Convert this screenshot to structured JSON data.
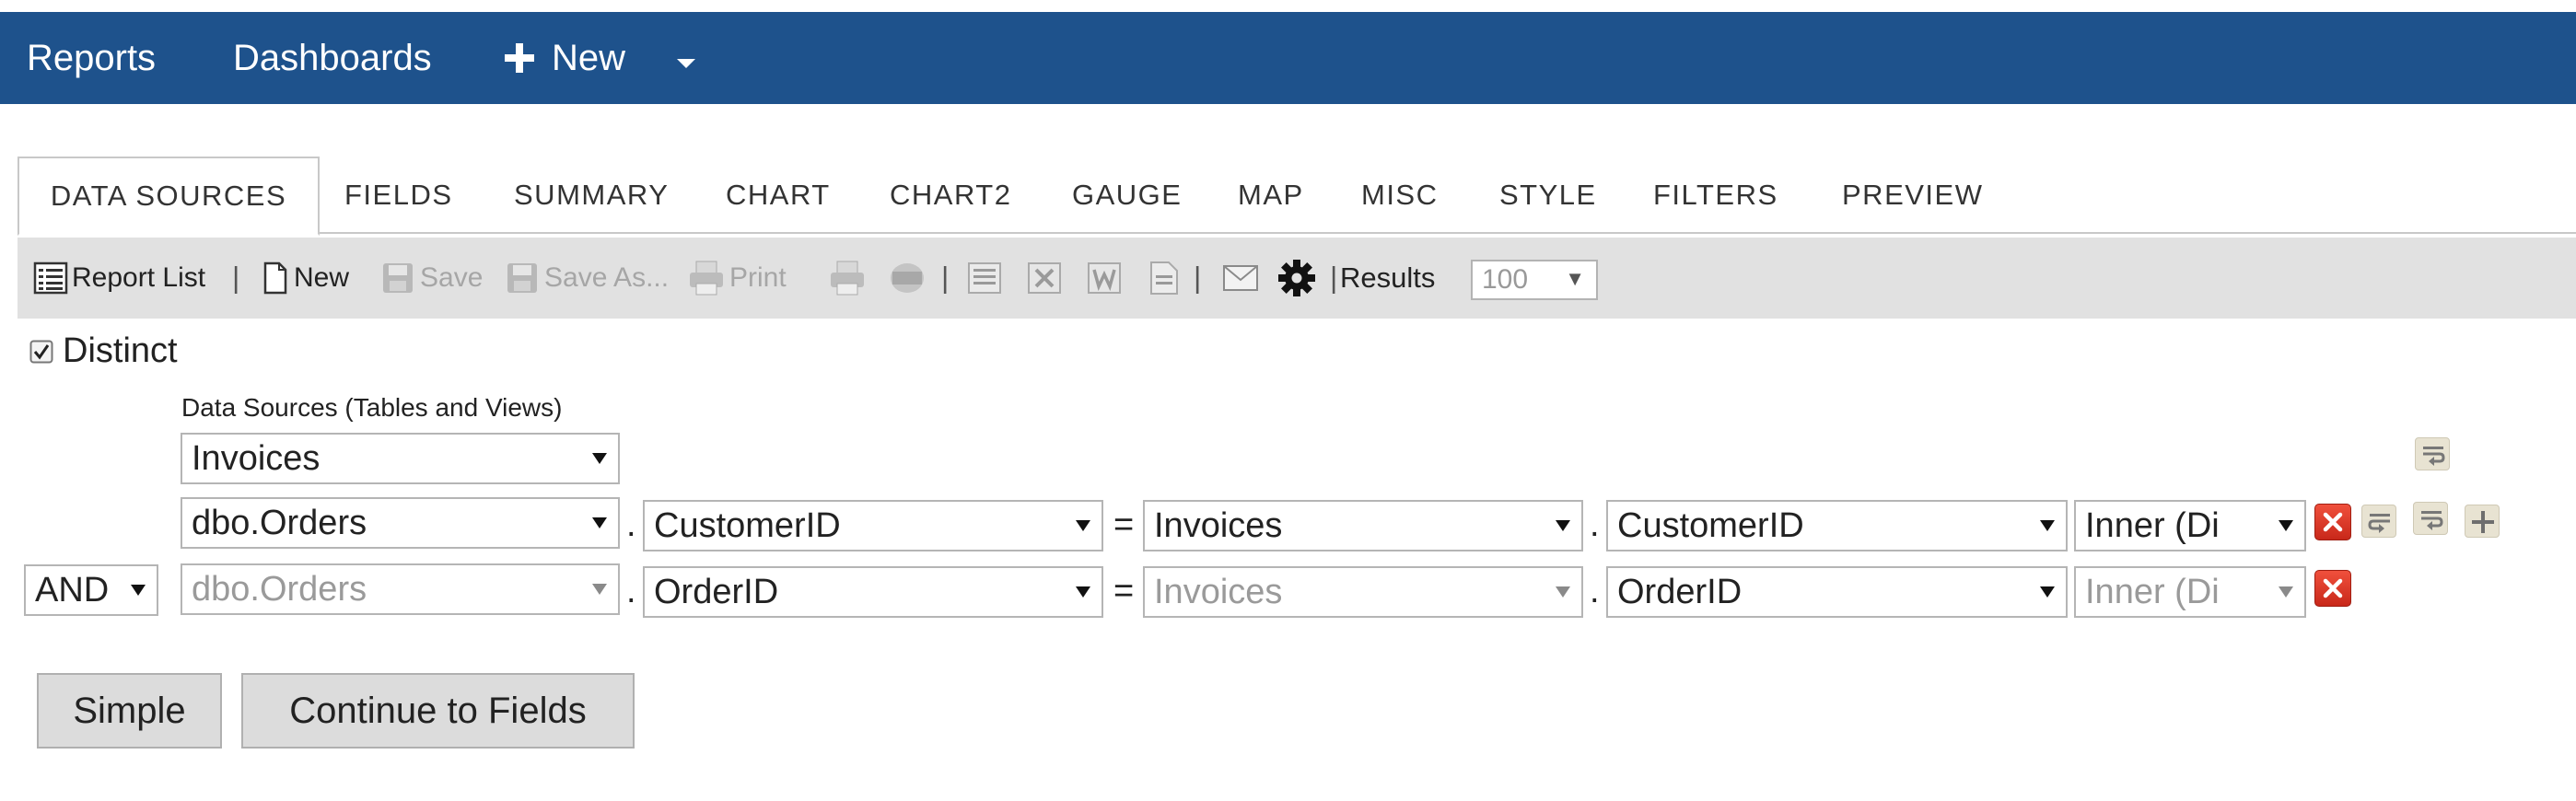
{
  "topnav": {
    "reports": "Reports",
    "dashboards": "Dashboards",
    "new": "New"
  },
  "tabs": [
    "DATA SOURCES",
    "FIELDS",
    "SUMMARY",
    "CHART",
    "CHART2",
    "GAUGE",
    "MAP",
    "MISC",
    "STYLE",
    "FILTERS",
    "PREVIEW"
  ],
  "toolbar": {
    "report_list": "Report List",
    "new": "New",
    "save": "Save",
    "save_as": "Save As...",
    "print": "Print",
    "results_label": "Results",
    "results_value": "100",
    "sep": "|"
  },
  "distinct": {
    "label": "Distinct",
    "checked": true
  },
  "datasources": {
    "heading": "Data Sources (Tables and Views)",
    "primary": "Invoices",
    "joins": [
      {
        "table": "dbo.Orders",
        "left_field": "CustomerID",
        "eq": "=",
        "right_table": "Invoices",
        "right_field": "CustomerID",
        "join_type": "Inner (Di"
      },
      {
        "conjunction": "AND",
        "table": "dbo.Orders",
        "left_field": "OrderID",
        "eq": "=",
        "right_table": "Invoices",
        "right_field": "OrderID",
        "join_type": "Inner (Di"
      }
    ],
    "dot": "."
  },
  "buttons": {
    "simple": "Simple",
    "continue": "Continue to Fields"
  },
  "colors": {
    "topbar": "#1e528c",
    "toolbar_bg": "#e1e1e1",
    "remove_red": "#d9352a"
  }
}
